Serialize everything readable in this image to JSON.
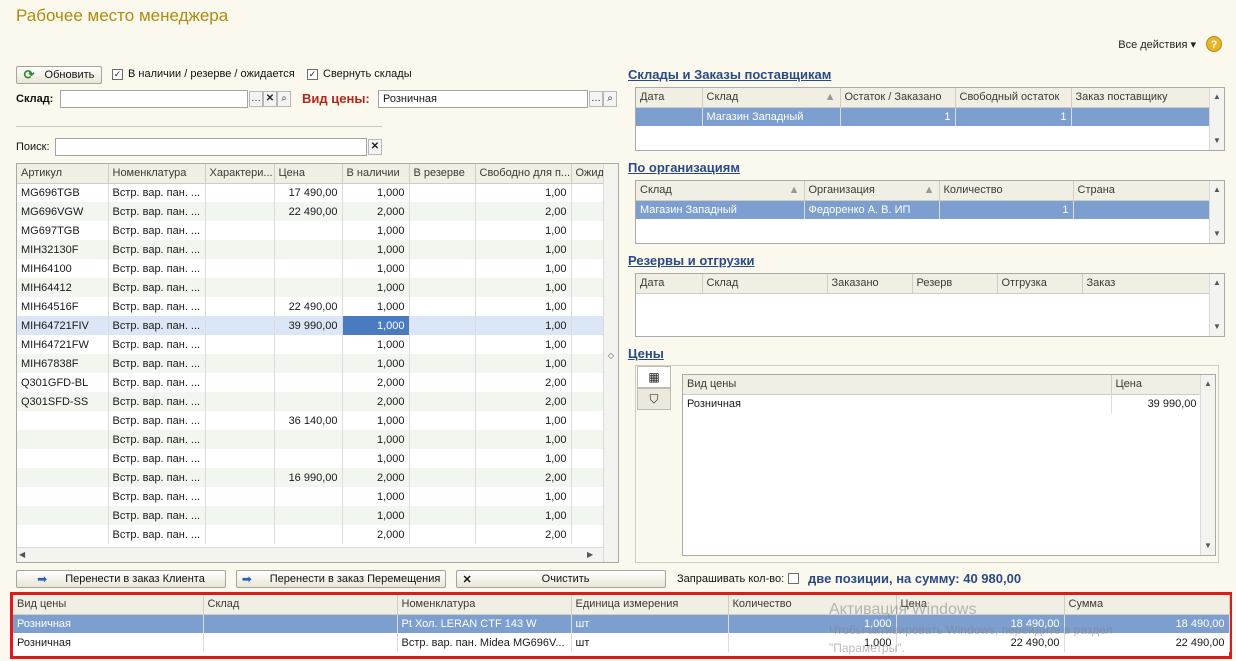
{
  "app": {
    "title": "Рабочее место менеджера",
    "all_actions": "Все действия ▾",
    "help": "?"
  },
  "toolbar": {
    "refresh_label": "Обновить",
    "in_stock_label": "В наличии / резерве / ожидается",
    "collapse_label": "Свернуть склады",
    "warehouse_label": "Склад:",
    "warehouse_value": "",
    "price_type_label": "Вид цены:",
    "price_type_value": "Розничная",
    "search_label": "Поиск:",
    "search_value": ""
  },
  "main_grid": {
    "columns": [
      "Артикул",
      "Номенклатура",
      "Характери...",
      "Цена",
      "В наличии",
      "В резерве",
      "Свободно для п...",
      "Ожид"
    ],
    "rows": [
      [
        "MG696TGB",
        "Встр. вар. пан. ...",
        "",
        "17 490,00",
        "1,000",
        "",
        "1,00",
        ""
      ],
      [
        "MG696VGW",
        "Встр. вар. пан. ...",
        "",
        "22 490,00",
        "2,000",
        "",
        "2,00",
        ""
      ],
      [
        "MG697TGB",
        "Встр. вар. пан. ...",
        "",
        "",
        "1,000",
        "",
        "1,00",
        ""
      ],
      [
        "MIH32130F",
        "Встр. вар. пан. ...",
        "",
        "",
        "1,000",
        "",
        "1,00",
        ""
      ],
      [
        "MIH64100",
        "Встр. вар. пан. ...",
        "",
        "",
        "1,000",
        "",
        "1,00",
        ""
      ],
      [
        "MIH64412",
        "Встр. вар. пан. ...",
        "",
        "",
        "1,000",
        "",
        "1,00",
        ""
      ],
      [
        "MIH64516F",
        "Встр. вар. пан. ...",
        "",
        "22 490,00",
        "1,000",
        "",
        "1,00",
        ""
      ],
      [
        "MIH64721FIV",
        "Встр. вар. пан. ...",
        "",
        "39 990,00",
        "1,000",
        "",
        "1,00",
        ""
      ],
      [
        "MIH64721FW",
        "Встр. вар. пан. ...",
        "",
        "",
        "1,000",
        "",
        "1,00",
        ""
      ],
      [
        "MIH67838F",
        "Встр. вар. пан. ...",
        "",
        "",
        "1,000",
        "",
        "1,00",
        ""
      ],
      [
        "Q301GFD-BL",
        "Встр. вар. пан. ...",
        "",
        "",
        "2,000",
        "",
        "2,00",
        ""
      ],
      [
        "Q301SFD-SS",
        "Встр. вар. пан. ...",
        "",
        "",
        "2,000",
        "",
        "2,00",
        ""
      ],
      [
        "",
        "Встр. вар. пан. ...",
        "",
        "36 140,00",
        "1,000",
        "",
        "1,00",
        ""
      ],
      [
        "",
        "Встр. вар. пан. ...",
        "",
        "",
        "1,000",
        "",
        "1,00",
        ""
      ],
      [
        "",
        "Встр. вар. пан. ...",
        "",
        "",
        "1,000",
        "",
        "1,00",
        ""
      ],
      [
        "",
        "Встр. вар. пан. ...",
        "",
        "16 990,00",
        "2,000",
        "",
        "2,00",
        ""
      ],
      [
        "",
        "Встр. вар. пан. ...",
        "",
        "",
        "1,000",
        "",
        "1,00",
        ""
      ],
      [
        "",
        "Встр. вар. пан. ...",
        "",
        "",
        "1,000",
        "",
        "1,00",
        ""
      ],
      [
        "",
        "Встр. вар. пан. ...",
        "",
        "",
        "2,000",
        "",
        "2,00",
        ""
      ]
    ]
  },
  "warehouses": {
    "title": "Склады и Заказы поставщикам",
    "columns": [
      "Дата",
      "Склад",
      "Остаток / Заказано",
      "Свободный остаток",
      "Заказ поставщику"
    ],
    "rows": [
      [
        "",
        "Магазин Западный",
        "1",
        "1",
        ""
      ]
    ]
  },
  "organizations": {
    "title": "По организациям",
    "columns": [
      "Склад",
      "Организация",
      "Количество",
      "Страна"
    ],
    "rows": [
      [
        "Магазин Западный",
        "Федоренко А. В. ИП",
        "1",
        ""
      ]
    ]
  },
  "reserves": {
    "title": "Резервы и отгрузки",
    "columns": [
      "Дата",
      "Склад",
      "Заказано",
      "Резерв",
      "Отгрузка",
      "Заказ"
    ]
  },
  "prices": {
    "title": "Цены",
    "columns": [
      "Вид цены",
      "Цена"
    ],
    "rows": [
      [
        "Розничная",
        "39 990,00"
      ]
    ]
  },
  "actions": {
    "to_client_order": "Перенести в заказ Клиента",
    "to_transfer_order": "Перенести в заказ Перемещения",
    "clear": "Очистить",
    "ask_qty_label": "Запрашивать кол-во:",
    "summary": "две позиции, на сумму: 40 980,00"
  },
  "order_grid": {
    "columns": [
      "Вид цены",
      "Склад",
      "Номенклатура",
      "Единица измерения",
      "Количество",
      "Цена",
      "Сумма"
    ],
    "rows": [
      [
        "Розничная",
        "",
        "Pt Хол. LERAN CTF 143 W",
        "шт",
        "1,000",
        "18 490,00",
        "18 490,00"
      ],
      [
        "Розничная",
        "",
        "Встр. вар. пан. Midea MG696V...",
        "шт",
        "1,000",
        "22 490,00",
        "22 490,00"
      ]
    ]
  },
  "watermark": {
    "line1": "Активация Windows",
    "line2": "Чтобы активировать Windows, перейдите в раздел",
    "line3": "\"Параметры\"."
  }
}
